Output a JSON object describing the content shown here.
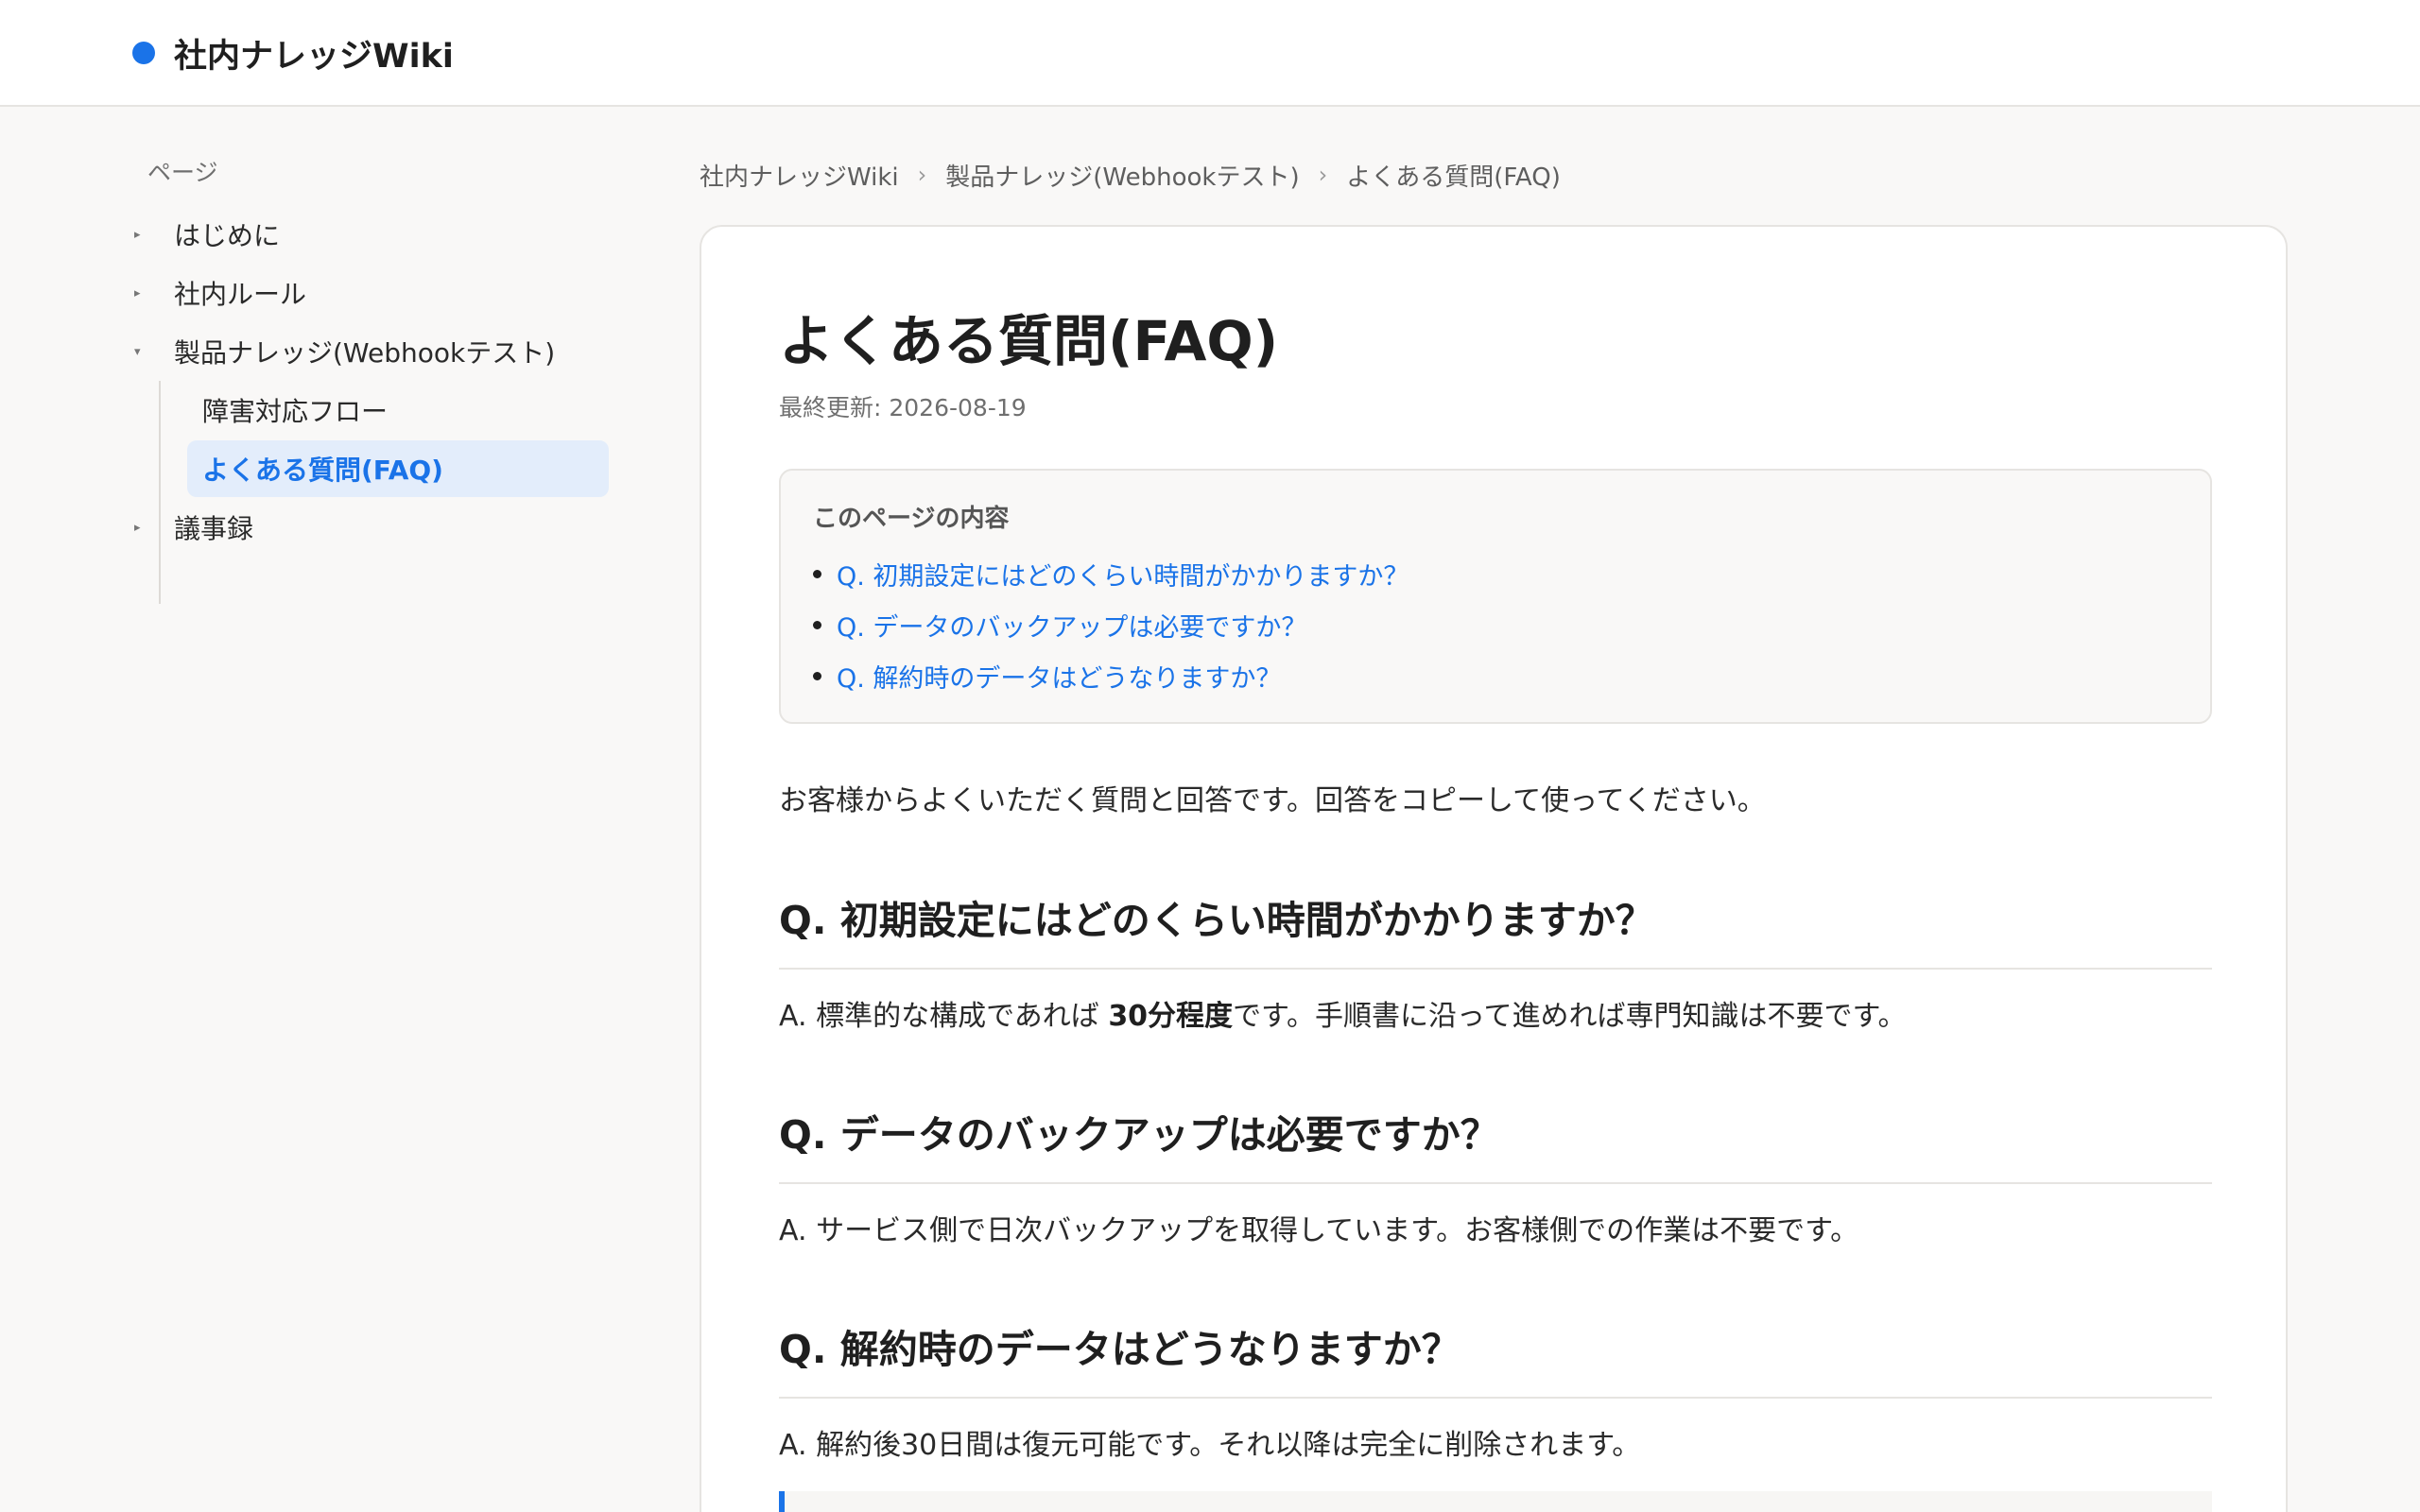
{
  "header": {
    "site_title": "社内ナレッジWiki",
    "accent_color": "#1a73e8"
  },
  "sidebar": {
    "title": "ページ",
    "items": [
      {
        "label": "はじめに",
        "expanded": false
      },
      {
        "label": "社内ルール",
        "expanded": false
      },
      {
        "label": "製品ナレッジ(Webhookテスト)",
        "expanded": true,
        "children": [
          {
            "label": "障害対応フロー",
            "active": false
          },
          {
            "label": "よくある質問(FAQ)",
            "active": true
          }
        ]
      },
      {
        "label": "議事録",
        "expanded": false
      }
    ]
  },
  "breadcrumb": [
    "社内ナレッジWiki",
    "製品ナレッジ(Webhookテスト)",
    "よくある質問(FAQ)"
  ],
  "article": {
    "title": "よくある質問(FAQ)",
    "updated": "最終更新: 2026-08-19",
    "toc": {
      "title": "このページの内容",
      "items": [
        "Q. 初期設定にはどのくらい時間がかかりますか？",
        "Q. データのバックアップは必要ですか？",
        "Q. 解約時のデータはどうなりますか？"
      ]
    },
    "intro": "お客様からよくいただく質問と回答です。回答をコピーして使ってください。",
    "faqs": [
      {
        "question": "Q. 初期設定にはどのくらい時間がかかりますか？",
        "answer_pre": "A. 標準的な構成であれば ",
        "answer_bold": "30分程度",
        "answer_post": "です。手順書に沿って進めれば専門知識は不要です。"
      },
      {
        "question": "Q. データのバックアップは必要ですか？",
        "answer": "A. サービス側で日次バックアップを取得しています。お客様側での作業は不要です。"
      },
      {
        "question": "Q. 解約時のデータはどうなりますか？",
        "answer": "A. 解約後30日間は復元可能です。それ以降は完全に削除されます。"
      }
    ]
  }
}
